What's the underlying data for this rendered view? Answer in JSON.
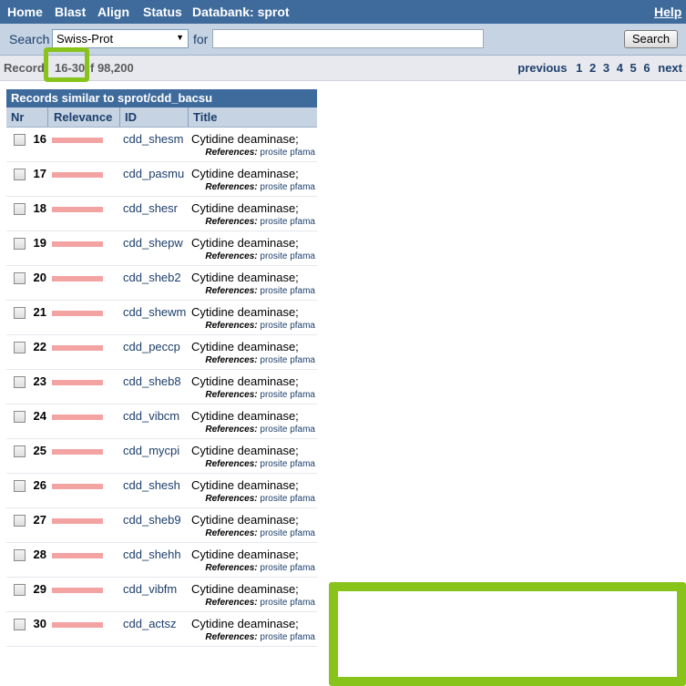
{
  "nav": {
    "items": [
      {
        "label": "Home",
        "name": "nav-home"
      },
      {
        "label": "Blast",
        "name": "nav-blast"
      },
      {
        "label": "Align",
        "name": "nav-align"
      },
      {
        "label": "Status",
        "name": "nav-status"
      },
      {
        "label": "Databank: sprot",
        "name": "nav-databank"
      }
    ],
    "help_label": "Help"
  },
  "search": {
    "label": "Search",
    "databank_value": "Swiss-Prot",
    "for_label": "for",
    "query_value": "",
    "button_label": "Search"
  },
  "records": {
    "prefix": "Record",
    "range": "16-30",
    "total": "f 98,200",
    "pager": {
      "previous": "previous",
      "pages": [
        "1",
        "2",
        "3",
        "4",
        "5",
        "6"
      ],
      "next": "next"
    }
  },
  "results": {
    "title": "Records similar to sprot/cdd_bacsu",
    "columns": {
      "nr": "Nr",
      "relevance": "Relevance",
      "id": "ID",
      "title": "Title"
    },
    "references_label": "References:",
    "ref_links": [
      "prosite",
      "pfama"
    ],
    "rows": [
      {
        "nr": "16",
        "id": "cdd_shesm",
        "title": "Cytidine deaminase;",
        "relevance": 1.0
      },
      {
        "nr": "17",
        "id": "cdd_pasmu",
        "title": "Cytidine deaminase;",
        "relevance": 1.0
      },
      {
        "nr": "18",
        "id": "cdd_shesr",
        "title": "Cytidine deaminase;",
        "relevance": 1.0
      },
      {
        "nr": "19",
        "id": "cdd_shepw",
        "title": "Cytidine deaminase;",
        "relevance": 1.0
      },
      {
        "nr": "20",
        "id": "cdd_sheb2",
        "title": "Cytidine deaminase;",
        "relevance": 1.0
      },
      {
        "nr": "21",
        "id": "cdd_shewm",
        "title": "Cytidine deaminase;",
        "relevance": 1.0
      },
      {
        "nr": "22",
        "id": "cdd_peccp",
        "title": "Cytidine deaminase;",
        "relevance": 1.0
      },
      {
        "nr": "23",
        "id": "cdd_sheb8",
        "title": "Cytidine deaminase;",
        "relevance": 1.0
      },
      {
        "nr": "24",
        "id": "cdd_vibcm",
        "title": "Cytidine deaminase;",
        "relevance": 1.0
      },
      {
        "nr": "25",
        "id": "cdd_mycpi",
        "title": "Cytidine deaminase;",
        "relevance": 1.0
      },
      {
        "nr": "26",
        "id": "cdd_shesh",
        "title": "Cytidine deaminase;",
        "relevance": 1.0
      },
      {
        "nr": "27",
        "id": "cdd_sheb9",
        "title": "Cytidine deaminase;",
        "relevance": 1.0
      },
      {
        "nr": "28",
        "id": "cdd_shehh",
        "title": "Cytidine deaminase;",
        "relevance": 1.0
      },
      {
        "nr": "29",
        "id": "cdd_vibfm",
        "title": "Cytidine deaminase;",
        "relevance": 1.0
      },
      {
        "nr": "30",
        "id": "cdd_actsz",
        "title": "Cytidine deaminase;",
        "relevance": 1.0
      }
    ]
  },
  "colors": {
    "nav_bg": "#3f6b9c",
    "bar_bg": "#c5d3e3",
    "relevance_bar": "#f4a3a3",
    "highlight": "#88c31a",
    "link": "#1d3f6b"
  }
}
